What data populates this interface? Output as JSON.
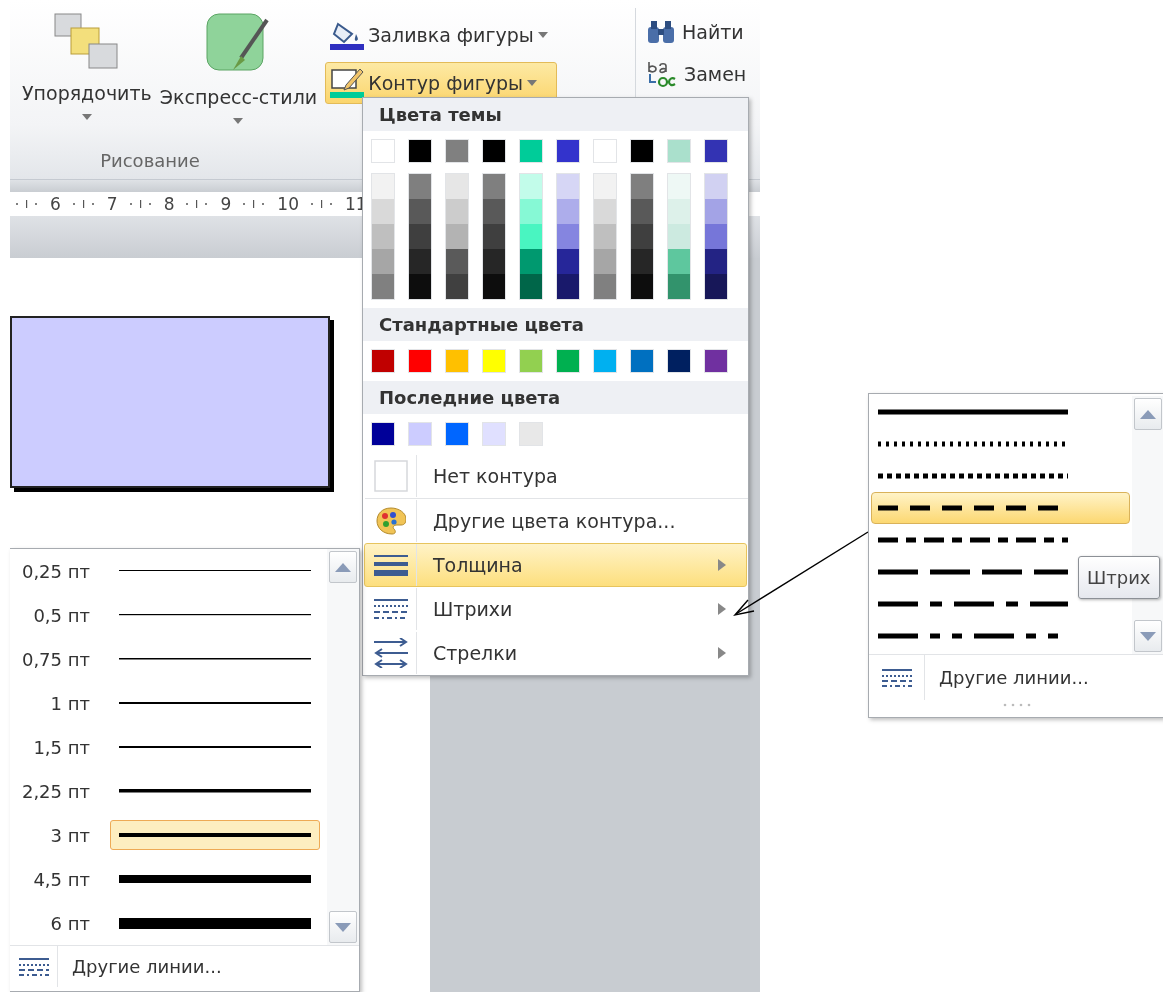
{
  "ribbon": {
    "large_buttons": [
      {
        "kind": "arrange",
        "label": "Упорядочить"
      },
      {
        "kind": "styles",
        "label": "Экспресс-стили"
      }
    ],
    "small_buttons": [
      {
        "kind": "fill",
        "label": "Заливка фигуры",
        "selected": false
      },
      {
        "kind": "outline",
        "label": "Контур фигуры",
        "selected": true
      }
    ],
    "group_label": "Рисование",
    "editing": [
      {
        "kind": "find",
        "label": "Найти"
      },
      {
        "kind": "replace",
        "label": "Замен"
      }
    ]
  },
  "ruler": {
    "ticks": [
      "6",
      "7",
      "8",
      "9",
      "10",
      "11"
    ]
  },
  "outline_menu": {
    "theme_heading": "Цвета темы",
    "theme_colors": [
      {
        "color": "#ffffff"
      },
      {
        "color": "#000000"
      },
      {
        "color": "#808080"
      },
      {
        "color": "#000000"
      },
      {
        "color": "#00cc99"
      },
      {
        "color": "#3333cc"
      },
      {
        "color": "#ffffff"
      },
      {
        "color": "#000000"
      },
      {
        "color": "#aae0cc"
      },
      {
        "color": "#3333b3"
      }
    ],
    "theme_shades": [
      {
        "cells": [
          {
            "color": "#f2f2f2"
          },
          {
            "color": "#d9d9d9"
          },
          {
            "color": "#bfbfbf"
          },
          {
            "color": "#a6a6a6"
          },
          {
            "color": "#808080"
          }
        ]
      },
      {
        "cells": [
          {
            "color": "#7f7f7f"
          },
          {
            "color": "#595959"
          },
          {
            "color": "#3f3f3f"
          },
          {
            "color": "#262626"
          },
          {
            "color": "#0d0d0d"
          }
        ]
      },
      {
        "cells": [
          {
            "color": "#e6e6e6"
          },
          {
            "color": "#cccccc"
          },
          {
            "color": "#b3b3b3"
          },
          {
            "color": "#5a5a5a"
          },
          {
            "color": "#404040"
          }
        ]
      },
      {
        "cells": [
          {
            "color": "#7f7f7f"
          },
          {
            "color": "#595959"
          },
          {
            "color": "#3f3f3f"
          },
          {
            "color": "#262626"
          },
          {
            "color": "#0d0d0d"
          }
        ]
      },
      {
        "cells": [
          {
            "color": "#c2fcea"
          },
          {
            "color": "#86f9d5"
          },
          {
            "color": "#49f5c1"
          },
          {
            "color": "#00996f"
          },
          {
            "color": "#006649"
          }
        ]
      },
      {
        "cells": [
          {
            "color": "#d6d6f5"
          },
          {
            "color": "#adadeb"
          },
          {
            "color": "#8585e0"
          },
          {
            "color": "#262699"
          },
          {
            "color": "#19196b"
          }
        ]
      },
      {
        "cells": [
          {
            "color": "#f2f2f2"
          },
          {
            "color": "#d9d9d9"
          },
          {
            "color": "#bfbfbf"
          },
          {
            "color": "#a6a6a6"
          },
          {
            "color": "#808080"
          }
        ]
      },
      {
        "cells": [
          {
            "color": "#7f7f7f"
          },
          {
            "color": "#595959"
          },
          {
            "color": "#3f3f3f"
          },
          {
            "color": "#262626"
          },
          {
            "color": "#0d0d0d"
          }
        ]
      },
      {
        "cells": [
          {
            "color": "#eef8f5"
          },
          {
            "color": "#ddf1ea"
          },
          {
            "color": "#cceae0"
          },
          {
            "color": "#5ec79e"
          },
          {
            "color": "#32936c"
          }
        ]
      },
      {
        "cells": [
          {
            "color": "#d1d1f2"
          },
          {
            "color": "#a3a3e6"
          },
          {
            "color": "#7676d9"
          },
          {
            "color": "#232384"
          },
          {
            "color": "#171758"
          }
        ]
      }
    ],
    "standard_heading": "Стандартные цвета",
    "standard_colors": [
      {
        "color": "#c00000"
      },
      {
        "color": "#ff0000"
      },
      {
        "color": "#ffc000"
      },
      {
        "color": "#ffff00"
      },
      {
        "color": "#92d050"
      },
      {
        "color": "#00b050"
      },
      {
        "color": "#00b0f0"
      },
      {
        "color": "#0070c0"
      },
      {
        "color": "#002060"
      },
      {
        "color": "#7030a0"
      }
    ],
    "recent_heading": "Последние цвета",
    "recent_colors": [
      {
        "color": "#000099"
      },
      {
        "color": "#ccccff"
      },
      {
        "color": "#0066ff"
      },
      {
        "color": "#e0e0ff"
      },
      {
        "color": "#e8e8e8"
      }
    ],
    "items": [
      {
        "kind": "none",
        "label": "Нет контура",
        "selected": false,
        "submenu": false
      },
      {
        "kind": "more_colors",
        "label": "Другие цвета контура...",
        "selected": false,
        "submenu": false
      },
      {
        "kind": "weight",
        "label": "Толщина",
        "selected": true,
        "submenu": true
      },
      {
        "kind": "dashes",
        "label": "Штрихи",
        "selected": false,
        "submenu": true
      },
      {
        "kind": "arrows",
        "label": "Стрелки",
        "selected": false,
        "submenu": true
      }
    ]
  },
  "weight_menu": {
    "items": [
      {
        "label": "0,25 пт",
        "selected": false
      },
      {
        "label": "0,5 пт",
        "selected": false
      },
      {
        "label": "0,75 пт",
        "selected": false
      },
      {
        "label": "1 пт",
        "selected": false
      },
      {
        "label": "1,5 пт",
        "selected": false
      },
      {
        "label": "2,25 пт",
        "selected": false
      },
      {
        "label": "3 пт",
        "selected": true
      },
      {
        "label": "4,5 пт",
        "selected": false
      },
      {
        "label": "6 пт",
        "selected": false
      }
    ],
    "footer": "Другие линии..."
  },
  "dash_menu": {
    "items": [
      {
        "kind": "solid",
        "selected": false
      },
      {
        "kind": "round_dot",
        "selected": false
      },
      {
        "kind": "square_dot",
        "selected": false
      },
      {
        "kind": "dash",
        "selected": true
      },
      {
        "kind": "dash_dot",
        "selected": false
      },
      {
        "kind": "long_dash",
        "selected": false
      },
      {
        "kind": "long_dash_dot",
        "selected": false
      },
      {
        "kind": "long_dash_dot_dot",
        "selected": false
      }
    ],
    "tooltip": "Штрих",
    "footer": "Другие линии..."
  }
}
